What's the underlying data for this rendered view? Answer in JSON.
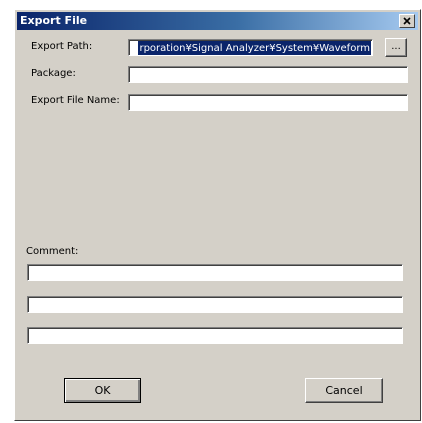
{
  "window": {
    "title": "Export File",
    "close_symbol": "×"
  },
  "form": {
    "export_path_label": "Export Path:",
    "export_path_value": "rporation¥Signal Analyzer¥System¥Waveform",
    "browse_label": "...",
    "package_label": "Package:",
    "package_value": "",
    "export_file_name_label": "Export File Name:",
    "export_file_name_value": "",
    "comment_label": "Comment:",
    "comment_lines": [
      "",
      "",
      ""
    ]
  },
  "buttons": {
    "ok_label": "OK",
    "cancel_label": "Cancel"
  },
  "colors": {
    "title_bar": "#0a246a",
    "dialog_face": "#d4d0c8",
    "selection": "#0a246a"
  }
}
